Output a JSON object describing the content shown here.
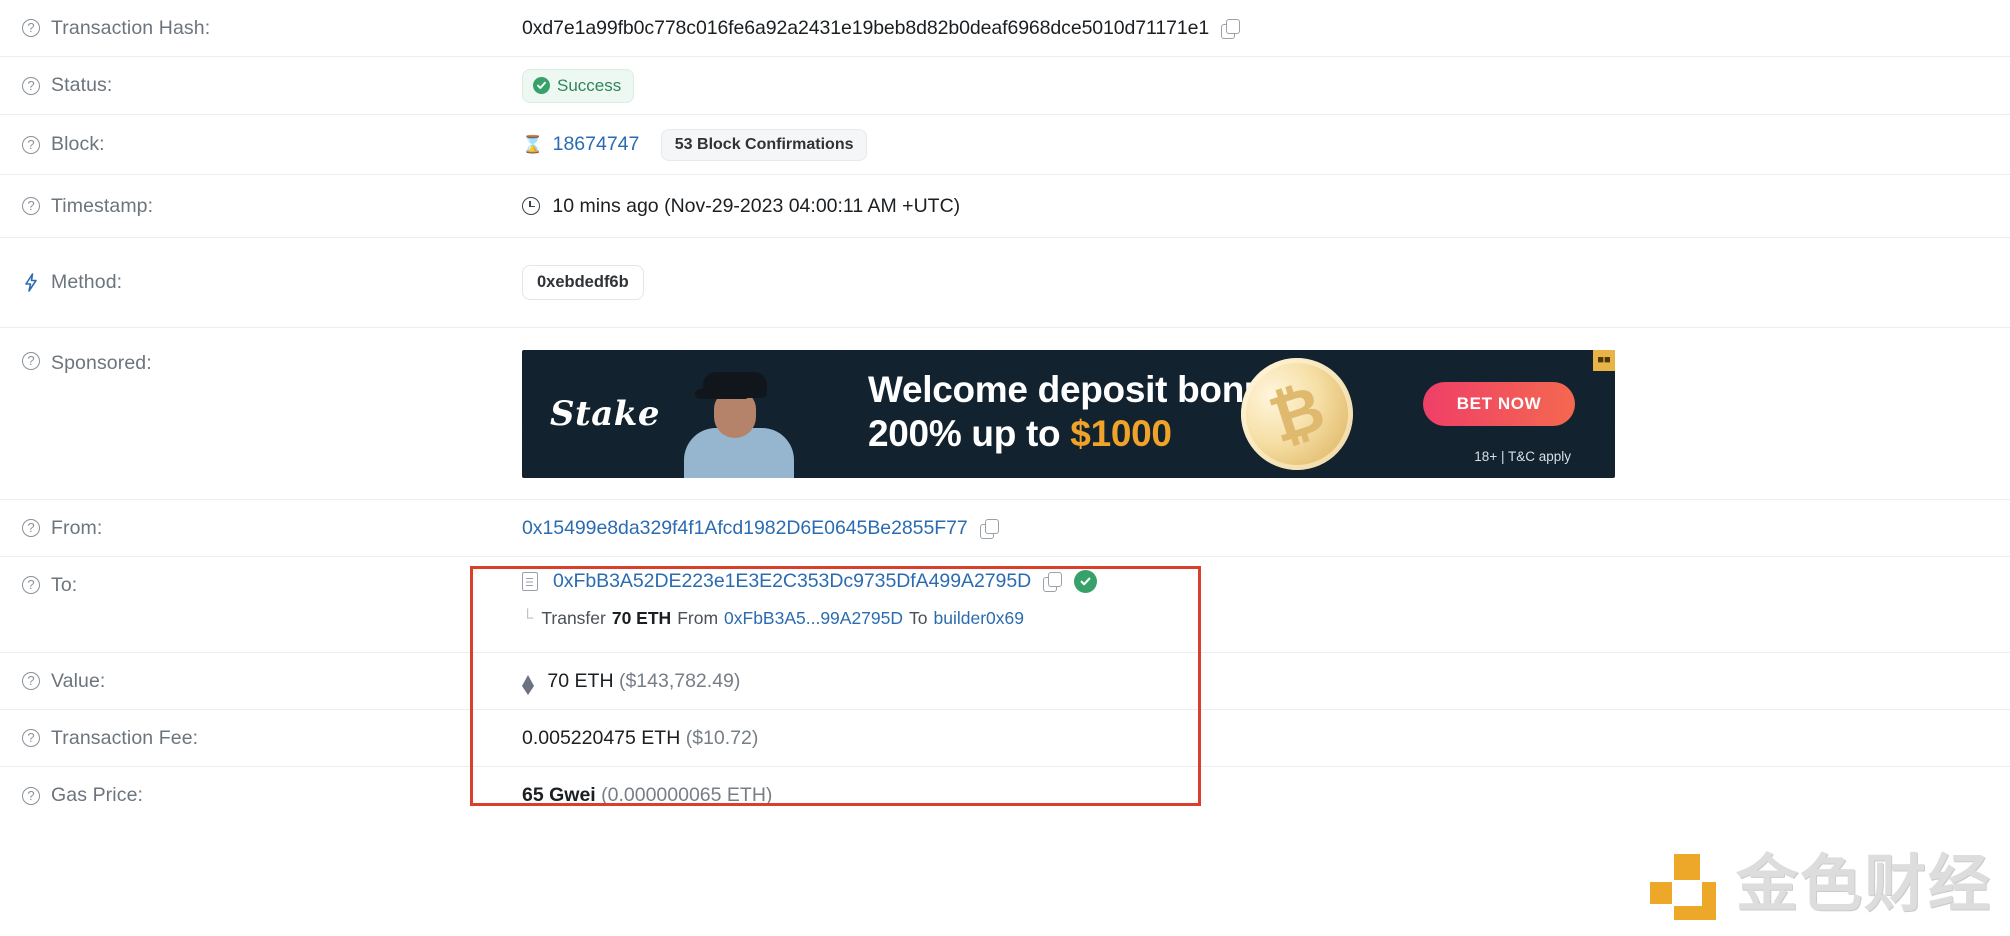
{
  "rows": {
    "transaction_hash": {
      "label": "Transaction Hash:",
      "value": "0xd7e1a99fb0c778c016fe6a92a2431e19beb8d82b0deaf6968dce5010d71171e1"
    },
    "status": {
      "label": "Status:",
      "value": "Success"
    },
    "block": {
      "label": "Block:",
      "value": "18674747",
      "confirmations": "53 Block Confirmations"
    },
    "timestamp": {
      "label": "Timestamp:",
      "value": "10 mins ago (Nov-29-2023 04:00:11 AM +UTC)"
    },
    "method": {
      "label": "Method:",
      "value": "0xebdedf6b"
    },
    "sponsored": {
      "label": "Sponsored:"
    },
    "from": {
      "label": "From:",
      "address": "0x15499e8da329f4f1Afcd1982D6E0645Be2855F77"
    },
    "to": {
      "label": "To:",
      "address": "0xFbB3A52DE223e1E3E2C353Dc9735DfA499A2795D",
      "transfer": {
        "corner": "└",
        "verb": "Transfer",
        "amount": "70 ETH",
        "from_word": "From",
        "from_addr": "0xFbB3A5...99A2795D",
        "to_word": "To",
        "to_name": "builder0x69"
      }
    },
    "value": {
      "label": "Value:",
      "amount": "70 ETH",
      "fiat": "($143,782.49)"
    },
    "transaction_fee": {
      "label": "Transaction Fee:",
      "amount": "0.005220475 ETH",
      "fiat": "($10.72)"
    },
    "gas_price": {
      "label": "Gas Price:",
      "amount": "65 Gwei",
      "eth": "(0.000000065 ETH)"
    }
  },
  "banner": {
    "brand": "Stake",
    "headline_line1": "Welcome deposit bonus",
    "headline_line2_pre": "200% up to ",
    "headline_line2_amount": "$1000",
    "cta": "BET NOW",
    "terms": "18+ | T&C apply",
    "ad_mark": "■■"
  },
  "watermark": {
    "text": "金色财经"
  },
  "colors": {
    "link": "#2b6cb0",
    "success": "#38a169",
    "highlight": "#d9402b",
    "watermark_orange": "#eda41f"
  }
}
